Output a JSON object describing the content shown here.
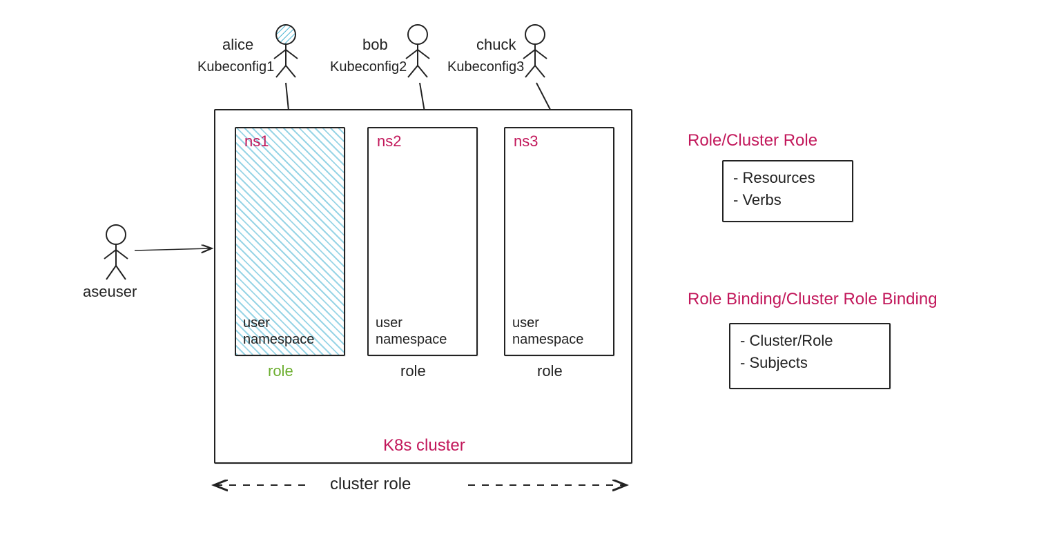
{
  "users": {
    "alice": {
      "name": "alice",
      "config": "Kubeconfig1"
    },
    "bob": {
      "name": "bob",
      "config": "Kubeconfig2"
    },
    "chuck": {
      "name": "chuck",
      "config": "Kubeconfig3"
    },
    "aseuser": {
      "name": "aseuser"
    }
  },
  "namespaces": {
    "ns1": {
      "title": "ns1",
      "line1": "user",
      "line2": "namespace",
      "role": "role"
    },
    "ns2": {
      "title": "ns2",
      "line1": "user",
      "line2": "namespace",
      "role": "role"
    },
    "ns3": {
      "title": "ns3",
      "line1": "user",
      "line2": "namespace",
      "role": "role"
    }
  },
  "cluster": {
    "title": "K8s cluster",
    "cluster_role_label": "cluster role"
  },
  "legend": {
    "role_header": "Role/Cluster Role",
    "role_items": [
      "Resources",
      "Verbs"
    ],
    "binding_header": "Role Binding/Cluster Role Binding",
    "binding_items": [
      "Cluster/Role",
      "Subjects"
    ]
  }
}
